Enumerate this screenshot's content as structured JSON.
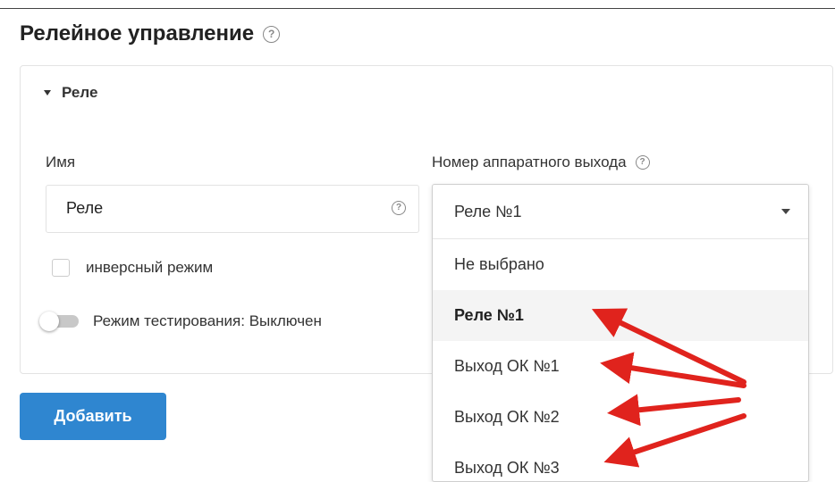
{
  "page": {
    "title": "Релейное управление"
  },
  "panel": {
    "header": "Реле",
    "name_label": "Имя",
    "name_value": "Реле",
    "output_label": "Номер аппаратного выхода",
    "inverse_label": "инверсный режим",
    "test_mode_label": "Режим тестирования: Выключен"
  },
  "dropdown": {
    "selected": "Реле №1",
    "options": [
      "Не выбрано",
      "Реле №1",
      "Выход ОК №1",
      "Выход ОК №2",
      "Выход ОК №3"
    ]
  },
  "add_button": "Добавить",
  "colors": {
    "accent": "#2f86d0",
    "annotation_arrow": "#e0231d"
  },
  "icons": {
    "help": "question-circle-icon",
    "caret": "caret-down-icon",
    "dropdown_arrow": "chevron-down-icon"
  }
}
